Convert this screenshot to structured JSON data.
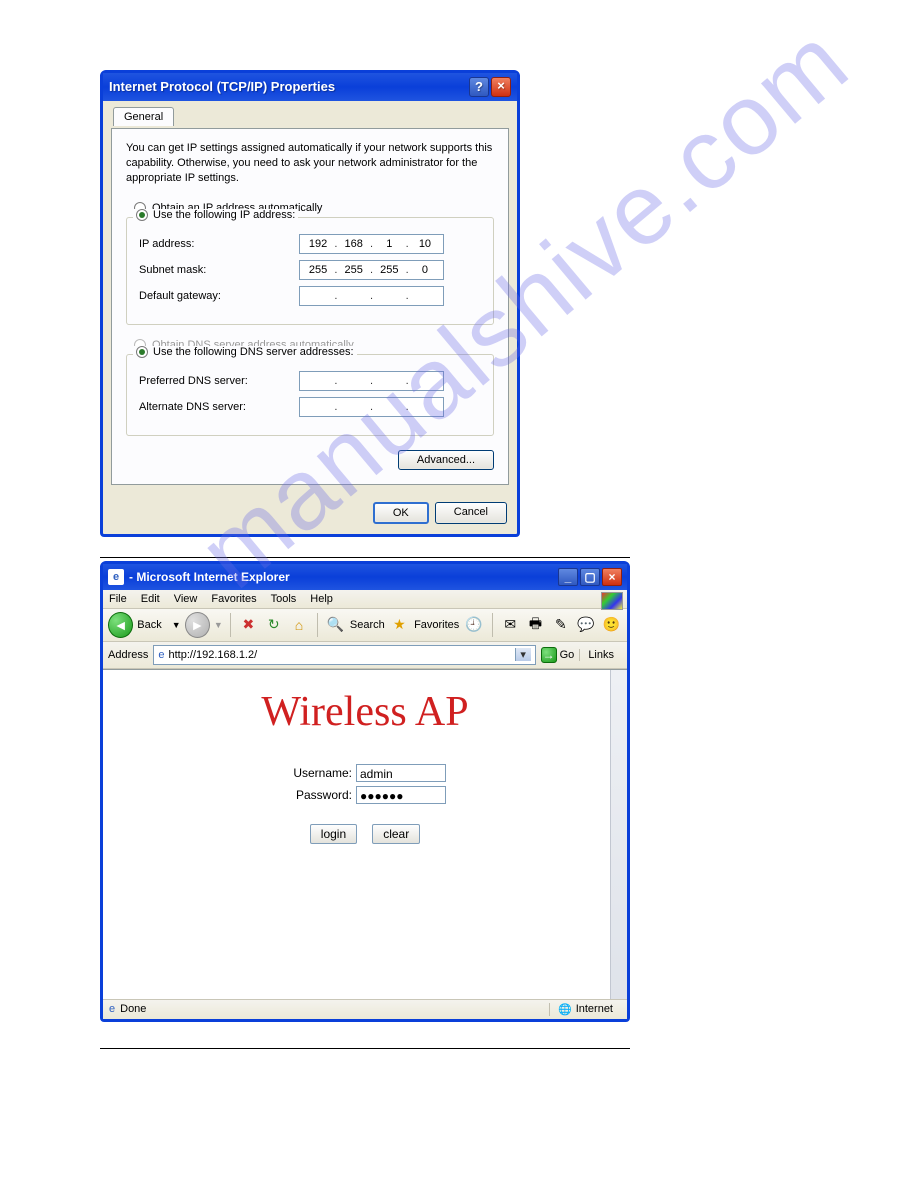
{
  "watermark": "manualshive.com",
  "dialogA": {
    "title": "Internet Protocol (TCP/IP) Properties",
    "help": "?",
    "close": "×",
    "tab_general": "General",
    "desc": "You can get IP settings assigned automatically if your network supports this capability. Otherwise, you need to ask your network administrator for the appropriate IP settings.",
    "radio_obtain_ip": "Obtain an IP address automatically",
    "radio_use_ip": "Use the following IP address:",
    "lbl_ip": "IP address:",
    "lbl_subnet": "Subnet mask:",
    "lbl_gateway": "Default gateway:",
    "ip": {
      "a": "192",
      "b": "168",
      "c": "1",
      "d": "10"
    },
    "subnet": {
      "a": "255",
      "b": "255",
      "c": "255",
      "d": "0"
    },
    "gateway": {
      "a": "",
      "b": "",
      "c": "",
      "d": ""
    },
    "radio_obtain_dns": "Obtain DNS server address automatically",
    "radio_use_dns": "Use the following DNS server addresses:",
    "lbl_pref_dns": "Preferred DNS server:",
    "lbl_alt_dns": "Alternate DNS server:",
    "btn_advanced": "Advanced...",
    "btn_ok": "OK",
    "btn_cancel": "Cancel"
  },
  "browser": {
    "title": " - Microsoft Internet Explorer",
    "menu": {
      "file": "File",
      "edit": "Edit",
      "view": "View",
      "favorites": "Favorites",
      "tools": "Tools",
      "help": "Help"
    },
    "toolbar": {
      "back": "Back",
      "search": "Search",
      "favorites": "Favorites"
    },
    "addr_label": "Address",
    "addr_value": "http://192.168.1.2/",
    "go": "Go",
    "links": "Links",
    "content": {
      "heading": "Wireless AP",
      "lbl_user": "Username:",
      "val_user": "admin",
      "lbl_pass": "Password:",
      "val_pass": "●●●●●●",
      "btn_login": "login",
      "btn_clear": "clear"
    },
    "status": {
      "done": "Done",
      "zone": "Internet"
    }
  }
}
